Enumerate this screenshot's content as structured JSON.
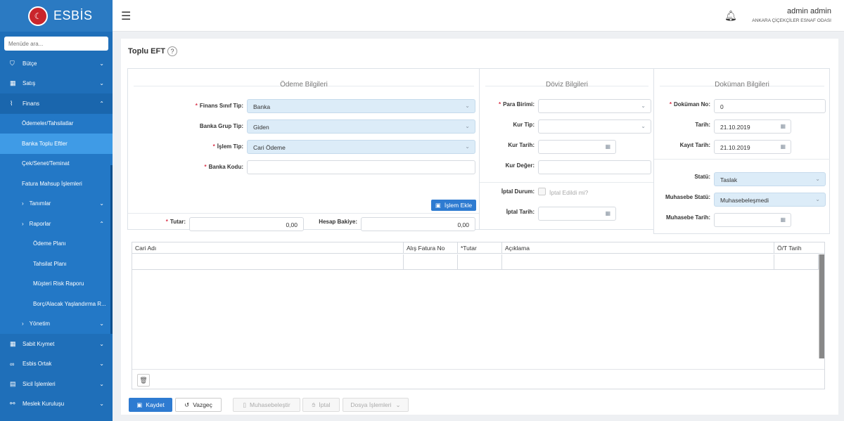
{
  "app": {
    "brand": "ESBİS",
    "logo_glyph": "☾"
  },
  "sidebar": {
    "search_placeholder": "Menüde ara...",
    "items": [
      {
        "label": "Bütçe",
        "icon": "shield-icon"
      },
      {
        "label": "Satış",
        "icon": "grid-icon"
      },
      {
        "label": "Finans",
        "icon": "chart-icon"
      },
      {
        "label": "Ödemeler/Tahsilatlar"
      },
      {
        "label": "Banka Toplu Eftler"
      },
      {
        "label": "Çek/Senet/Teminat"
      },
      {
        "label": "Fatura Mahsup İşlemleri"
      },
      {
        "label": "Tanımlar"
      },
      {
        "label": "Raporlar"
      },
      {
        "label": "Ödeme Planı"
      },
      {
        "label": "Tahsilat Planı"
      },
      {
        "label": "Müşteri Risk Raporu"
      },
      {
        "label": "Borç/Alacak Yaşlandırma R..."
      },
      {
        "label": "Yönetim"
      },
      {
        "label": "Sabit Kıymet",
        "icon": "grid-icon"
      },
      {
        "label": "Esbis Ortak",
        "icon": "link-icon"
      },
      {
        "label": "Sicil İşlemleri",
        "icon": "doc-icon"
      },
      {
        "label": "Meslek Kuruluşu",
        "icon": "share-icon"
      }
    ]
  },
  "header": {
    "user_name": "admin admin",
    "org": "ANKARA ÇİÇEKÇİLER ESNAF ODASI"
  },
  "page": {
    "title": "Toplu EFT",
    "help": "?"
  },
  "odeme": {
    "title": "Ödeme Bilgileri",
    "finans_sinif_tip_label": "Finans Sınıf Tip",
    "finans_sinif_tip_value": "Banka",
    "banka_grup_tip_label": "Banka Grup Tip",
    "banka_grup_tip_value": "Giden",
    "islem_tip_label": "İşlem Tip",
    "islem_tip_value": "Cari Ödeme",
    "banka_kodu_label": "Banka Kodu",
    "banka_kodu_value": "",
    "islem_ekle": "İşlem Ekle",
    "tutar_label": "Tutar",
    "tutar_value": "0,00",
    "hesap_bakiye_label": "Hesap Bakiye",
    "hesap_bakiye_value": "0,00"
  },
  "doviz": {
    "title": "Döviz Bilgileri",
    "para_birimi_label": "Para Birimi",
    "kur_tip_label": "Kur Tip",
    "kur_tarih_label": "Kur Tarih",
    "kur_deger_label": "Kur Değer",
    "iptal_durum_label": "İptal Durum",
    "iptal_edildi_text": "İptal Edildi mi?",
    "iptal_tarih_label": "İptal Tarih"
  },
  "dokuman": {
    "title": "Doküman Bilgileri",
    "dokuman_no_label": "Doküman No",
    "dokuman_no_value": "0",
    "tarih_label": "Tarih",
    "tarih_value": "21.10.2019",
    "kayit_tarih_label": "Kayıt Tarih",
    "kayit_tarih_value": "21.10.2019",
    "statu_label": "Statü",
    "statu_value": "Taslak",
    "muhasebe_statu_label": "Muhasebe Statü",
    "muhasebe_statu_value": "Muhasebeleşmedi",
    "muhasebe_tarih_label": "Muhasebe Tarih"
  },
  "grid": {
    "columns": [
      "Cari Adı",
      "Alış Fatura No",
      "*Tutar",
      "Açıklama",
      "Ö/T Tarih"
    ]
  },
  "footer": {
    "kaydet": "Kaydet",
    "vazgec": "Vazgeç",
    "muhasebelestir": "Muhasebeleştir",
    "iptal": "İptal",
    "dosya_islemleri": "Dosya İşlemleri"
  },
  "colors": {
    "sidebar": "#1f6fb9",
    "active": "#3f9be6",
    "primary": "#2e7bd1",
    "required": "#d9334a",
    "select_bg": "#dcecf8"
  }
}
